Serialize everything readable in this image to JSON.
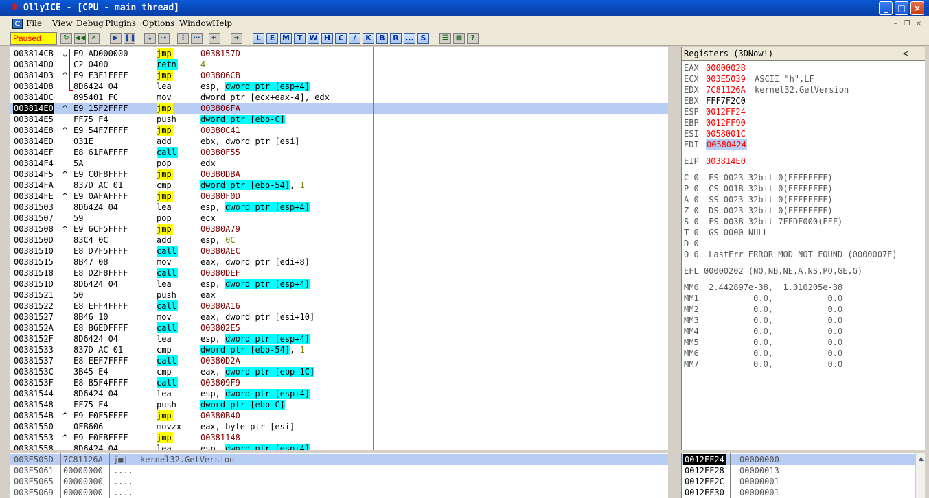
{
  "window": {
    "title": "OllyICE - [CPU - main thread]",
    "minimize": "_",
    "maximize": "□",
    "close": "×"
  },
  "menu": [
    "File",
    "View",
    "Debug",
    "Plugins",
    "Options",
    "Window",
    "Help"
  ],
  "status": "Paused",
  "toolbar_letters": [
    "L",
    "E",
    "M",
    "T",
    "W",
    "H",
    "C",
    "/",
    "K",
    "B",
    "R",
    "...",
    "S"
  ],
  "disasm": [
    {
      "addr": "003814CB",
      "mark": "⌄",
      "hex": "E9 AD000000",
      "mn": "jmp",
      "mnc": "y",
      "op": [
        [
          "0038157D",
          "tgt"
        ]
      ]
    },
    {
      "addr": "003814D0",
      "mark": "",
      "hex": "C2 0400",
      "mn": "retn",
      "mnc": "c",
      "op": [
        [
          "4",
          "num"
        ]
      ]
    },
    {
      "addr": "003814D3",
      "mark": "^",
      "hex": "E9 F3F1FFFF",
      "mn": "jmp",
      "mnc": "y",
      "op": [
        [
          "003806CB",
          "tgt"
        ]
      ]
    },
    {
      "addr": "003814D8",
      "mark": "",
      "hex": "8D6424 04",
      "mn": "lea",
      "mnc": "",
      "op": [
        [
          "esp, ",
          ""
        ],
        [
          "dword ptr [esp+4]",
          "cyan"
        ]
      ]
    },
    {
      "addr": "003814DC",
      "mark": "",
      "hex": "895401 FC",
      "mn": "mov",
      "mnc": "",
      "op": [
        [
          "dword ptr [ecx+eax-4], edx",
          ""
        ]
      ]
    },
    {
      "addr": "003814E0",
      "mark": "^",
      "hex": "E9 15F2FFFF",
      "mn": "jmp",
      "mnc": "y",
      "op": [
        [
          "003806FA",
          "tgt"
        ]
      ],
      "sel": true
    },
    {
      "addr": "003814E5",
      "mark": "",
      "hex": "FF75 F4",
      "mn": "push",
      "mnc": "",
      "op": [
        [
          "dword ptr [ebp-C]",
          "cyan"
        ]
      ]
    },
    {
      "addr": "003814E8",
      "mark": "^",
      "hex": "E9 54F7FFFF",
      "mn": "jmp",
      "mnc": "y",
      "op": [
        [
          "00380C41",
          "tgt"
        ]
      ]
    },
    {
      "addr": "003814ED",
      "mark": "",
      "hex": "031E",
      "mn": "add",
      "mnc": "",
      "op": [
        [
          "ebx, dword ptr [esi]",
          ""
        ]
      ]
    },
    {
      "addr": "003814EF",
      "mark": "",
      "hex": "E8 61FAFFFF",
      "mn": "call",
      "mnc": "c",
      "op": [
        [
          "00380F55",
          "tgt"
        ]
      ]
    },
    {
      "addr": "003814F4",
      "mark": "",
      "hex": "5A",
      "mn": "pop",
      "mnc": "",
      "op": [
        [
          "edx",
          ""
        ]
      ]
    },
    {
      "addr": "003814F5",
      "mark": "^",
      "hex": "E9 C0F8FFFF",
      "mn": "jmp",
      "mnc": "y",
      "op": [
        [
          "00380DBA",
          "tgt"
        ]
      ]
    },
    {
      "addr": "003814FA",
      "mark": "",
      "hex": "837D AC 01",
      "mn": "cmp",
      "mnc": "",
      "op": [
        [
          "dword ptr [ebp-54]",
          "cyan"
        ],
        [
          ", ",
          ""
        ],
        [
          "1",
          "num"
        ]
      ]
    },
    {
      "addr": "003814FE",
      "mark": "^",
      "hex": "E9 0AFAFFFF",
      "mn": "jmp",
      "mnc": "y",
      "op": [
        [
          "00380F0D",
          "tgt"
        ]
      ]
    },
    {
      "addr": "00381503",
      "mark": "",
      "hex": "8D6424 04",
      "mn": "lea",
      "mnc": "",
      "op": [
        [
          "esp, ",
          ""
        ],
        [
          "dword ptr [esp+4]",
          "cyan"
        ]
      ]
    },
    {
      "addr": "00381507",
      "mark": "",
      "hex": "59",
      "mn": "pop",
      "mnc": "",
      "op": [
        [
          "ecx",
          ""
        ]
      ]
    },
    {
      "addr": "00381508",
      "mark": "^",
      "hex": "E9 6CF5FFFF",
      "mn": "jmp",
      "mnc": "y",
      "op": [
        [
          "00380A79",
          "tgt"
        ]
      ]
    },
    {
      "addr": "0038150D",
      "mark": "",
      "hex": "83C4 0C",
      "mn": "add",
      "mnc": "",
      "op": [
        [
          "esp, ",
          ""
        ],
        [
          "0C",
          "num"
        ]
      ]
    },
    {
      "addr": "00381510",
      "mark": "",
      "hex": "E8 D7F5FFFF",
      "mn": "call",
      "mnc": "c",
      "op": [
        [
          "00380AEC",
          "tgt"
        ]
      ]
    },
    {
      "addr": "00381515",
      "mark": "",
      "hex": "8B47 08",
      "mn": "mov",
      "mnc": "",
      "op": [
        [
          "eax, dword ptr [edi+8]",
          ""
        ]
      ]
    },
    {
      "addr": "00381518",
      "mark": "",
      "hex": "E8 D2F8FFFF",
      "mn": "call",
      "mnc": "c",
      "op": [
        [
          "00380DEF",
          "tgt"
        ]
      ]
    },
    {
      "addr": "0038151D",
      "mark": "",
      "hex": "8D6424 04",
      "mn": "lea",
      "mnc": "",
      "op": [
        [
          "esp, ",
          ""
        ],
        [
          "dword ptr [esp+4]",
          "cyan"
        ]
      ]
    },
    {
      "addr": "00381521",
      "mark": "",
      "hex": "50",
      "mn": "push",
      "mnc": "",
      "op": [
        [
          "eax",
          ""
        ]
      ]
    },
    {
      "addr": "00381522",
      "mark": "",
      "hex": "E8 EFF4FFFF",
      "mn": "call",
      "mnc": "c",
      "op": [
        [
          "00380A16",
          "tgt"
        ]
      ]
    },
    {
      "addr": "00381527",
      "mark": "",
      "hex": "8B46 10",
      "mn": "mov",
      "mnc": "",
      "op": [
        [
          "eax, dword ptr [esi+10]",
          ""
        ]
      ]
    },
    {
      "addr": "0038152A",
      "mark": "",
      "hex": "E8 B6EDFFFF",
      "mn": "call",
      "mnc": "c",
      "op": [
        [
          "003802E5",
          "tgt"
        ]
      ]
    },
    {
      "addr": "0038152F",
      "mark": "",
      "hex": "8D6424 04",
      "mn": "lea",
      "mnc": "",
      "op": [
        [
          "esp, ",
          ""
        ],
        [
          "dword ptr [esp+4]",
          "cyan"
        ]
      ]
    },
    {
      "addr": "00381533",
      "mark": "",
      "hex": "837D AC 01",
      "mn": "cmp",
      "mnc": "",
      "op": [
        [
          "dword ptr [ebp-54]",
          "cyan"
        ],
        [
          ", ",
          ""
        ],
        [
          "1",
          "num"
        ]
      ]
    },
    {
      "addr": "00381537",
      "mark": "",
      "hex": "E8 EEF7FFFF",
      "mn": "call",
      "mnc": "c",
      "op": [
        [
          "00380D2A",
          "tgt"
        ]
      ]
    },
    {
      "addr": "0038153C",
      "mark": "",
      "hex": "3B45 E4",
      "mn": "cmp",
      "mnc": "",
      "op": [
        [
          "eax, ",
          ""
        ],
        [
          "dword ptr [ebp-1C]",
          "cyan"
        ]
      ]
    },
    {
      "addr": "0038153F",
      "mark": "",
      "hex": "E8 B5F4FFFF",
      "mn": "call",
      "mnc": "c",
      "op": [
        [
          "003809F9",
          "tgt"
        ]
      ]
    },
    {
      "addr": "00381544",
      "mark": "",
      "hex": "8D6424 04",
      "mn": "lea",
      "mnc": "",
      "op": [
        [
          "esp, ",
          ""
        ],
        [
          "dword ptr [esp+4]",
          "cyan"
        ]
      ]
    },
    {
      "addr": "00381548",
      "mark": "",
      "hex": "FF75 F4",
      "mn": "push",
      "mnc": "",
      "op": [
        [
          "dword ptr [ebp-C]",
          "cyan"
        ]
      ]
    },
    {
      "addr": "0038154B",
      "mark": "^",
      "hex": "E9 F0F5FFFF",
      "mn": "jmp",
      "mnc": "y",
      "op": [
        [
          "00380B40",
          "tgt"
        ]
      ]
    },
    {
      "addr": "00381550",
      "mark": "",
      "hex": "0FB606",
      "mn": "movzx",
      "mnc": "",
      "op": [
        [
          "eax, byte ptr [esi]",
          ""
        ]
      ]
    },
    {
      "addr": "00381553",
      "mark": "^",
      "hex": "E9 F0FBFFFF",
      "mn": "jmp",
      "mnc": "y",
      "op": [
        [
          "00381148",
          "tgt"
        ]
      ]
    },
    {
      "addr": "00381558",
      "mark": "",
      "hex": "8D6424 04",
      "mn": "lea",
      "mnc": "",
      "op": [
        [
          "esp, ",
          ""
        ],
        [
          "dword ptr [esp+4]",
          "cyan"
        ]
      ]
    }
  ],
  "registers": {
    "header": "Registers (3DNow!)",
    "collapse": "<",
    "gp": [
      {
        "name": "EAX",
        "val": "00000028",
        "comment": "",
        "red": true
      },
      {
        "name": "ECX",
        "val": "003E5039",
        "comment": "ASCII \"h\",LF",
        "red": true
      },
      {
        "name": "EDX",
        "val": "7C81126A",
        "comment": "kernel32.GetVersion",
        "red": true
      },
      {
        "name": "EBX",
        "val": "FFF7F2C0",
        "comment": "",
        "red": false
      },
      {
        "name": "ESP",
        "val": "0012FF24",
        "comment": "",
        "red": true
      },
      {
        "name": "EBP",
        "val": "0012FF90",
        "comment": "",
        "red": true
      },
      {
        "name": "ESI",
        "val": "0058001C",
        "comment": "",
        "red": true
      },
      {
        "name": "EDI",
        "val": "00580424",
        "comment": "",
        "red": true,
        "hl": true
      }
    ],
    "eip": {
      "name": "EIP",
      "val": "003814E0"
    },
    "flags": [
      "C 0  ES 0023 32bit 0(FFFFFFFF)",
      "P 0  CS 001B 32bit 0(FFFFFFFF)",
      "A 0  SS 0023 32bit 0(FFFFFFFF)",
      "Z 0  DS 0023 32bit 0(FFFFFFFF)",
      "S 0  FS 003B 32bit 7FFDF000(FFF)",
      "T 0  GS 0000 NULL",
      "D 0",
      "O 0  LastErr ERROR_MOD_NOT_FOUND (0000007E)"
    ],
    "efl": "EFL 00000202 (NO,NB,NE,A,NS,PO,GE,G)",
    "mmx": [
      "MM0  2.442897e-38,  1.010205e-38",
      "MM1           0.0,           0.0",
      "MM2           0.0,           0.0",
      "MM3           0.0,           0.0",
      "MM4           0.0,           0.0",
      "MM5           0.0,           0.0",
      "MM6           0.0,           0.0",
      "MM7           0.0,           0.0"
    ]
  },
  "dump": [
    {
      "addr": "003E505D",
      "hex": "7C81126A",
      "ascii": "j■|",
      "comment": "kernel32.GetVersion",
      "sel": true
    },
    {
      "addr": "003E5061",
      "hex": "00000000",
      "ascii": "....",
      "comment": ""
    },
    {
      "addr": "003E5065",
      "hex": "00000000",
      "ascii": "....",
      "comment": ""
    },
    {
      "addr": "003E5069",
      "hex": "00000000",
      "ascii": "....",
      "comment": ""
    }
  ],
  "stack": [
    {
      "addr": "0012FF24",
      "val": "00000000",
      "sel": true
    },
    {
      "addr": "0012FF28",
      "val": "00000013"
    },
    {
      "addr": "0012FF2C",
      "val": "00000001"
    },
    {
      "addr": "0012FF30",
      "val": "00000001"
    }
  ],
  "colors": {
    "accent": "#0a5ad6",
    "selection": "#b7cdf4",
    "jmp": "#ffff00",
    "call": "#00ffff",
    "status_bg": "#ffff00"
  }
}
